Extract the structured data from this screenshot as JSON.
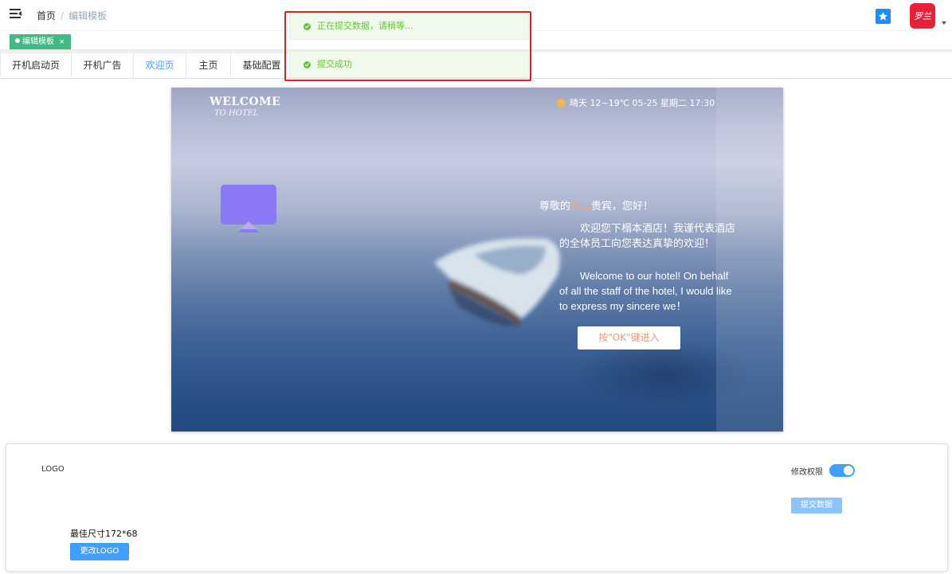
{
  "breadcrumb": {
    "home": "首页",
    "separator": "/",
    "current": "编辑模板"
  },
  "tags_view": {
    "active_tag": "编辑模板",
    "close_glyph": "×"
  },
  "tabs": [
    {
      "label": "开机启动页",
      "active": false
    },
    {
      "label": "开机广告",
      "active": false
    },
    {
      "label": "欢迎页",
      "active": true
    },
    {
      "label": "主页",
      "active": false
    },
    {
      "label": "基础配置",
      "active": false
    }
  ],
  "notifications": [
    {
      "text": "正在提交数据，请稍等...",
      "type": "success"
    },
    {
      "text": "提交成功",
      "type": "success"
    }
  ],
  "header_icons": {
    "star": "star-icon",
    "avatar": "avatar",
    "avatar_text": "罗兰",
    "dropdown": "chevron-down-icon"
  },
  "preview": {
    "watermark_line1": "WELCOME",
    "watermark_line2": "TO HOTEL",
    "weather": "晴天 12~19℃  05-25 星期二   17:30",
    "greeting_prefix": "尊敬的",
    "guest_name": "张三",
    "greeting_suffix": "贵宾，您好！",
    "welcome_cn": "欢迎您下榻本酒店！我谨代表酒店的全体员工向您表达真挚的欢迎！",
    "welcome_en": "Welcome to our hotel! On behalf of all the staff of the hotel, I would like to express my sincere we！",
    "ok_button": "按\"OK\"键进入"
  },
  "settings": {
    "logo_label": "LOGO",
    "permission_label": "修改权限",
    "permission_enabled": true,
    "submit_button": "提交数据",
    "size_hint": "最佳尺寸172*68",
    "change_logo_button": "更改LOGO"
  },
  "colors": {
    "primary": "#409eff",
    "tag_green": "#42b983",
    "success": "#67c23a",
    "highlight_border": "#e02020",
    "guest_name": "#f0a58a",
    "ok_text": "#e39b79"
  }
}
